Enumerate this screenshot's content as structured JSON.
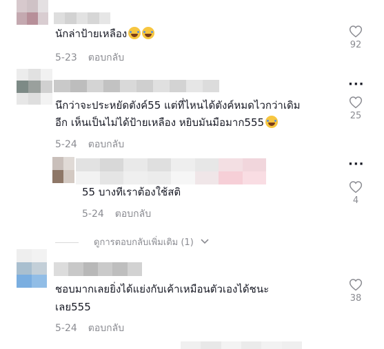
{
  "comments": [
    {
      "text_lines": [
        "นักล่าป้ายเหลือง"
      ],
      "emoji_count": 2,
      "date": "5-23",
      "reply_label": "ตอบกลับ",
      "likes": "92"
    },
    {
      "text_lines": [
        "นึกว่าจะประหยัดตังค์55 แต่ที่ไหนได้ตังค์หมดไวกว่าเดิม",
        "อีก เห็นเป็นไม่ได้ป้ายเหลือง หยิบมันมือมาก555"
      ],
      "emoji_count": 1,
      "date": "5-24",
      "reply_label": "ตอบกลับ",
      "likes": "25",
      "replies": [
        {
          "text_lines": [
            "55 บางทีเราต้องใช้สติ"
          ],
          "date": "5-24",
          "reply_label": "ตอบกลับ",
          "likes": "4"
        }
      ],
      "view_more": "ดูการตอบกลับเพิ่มเติม (1)"
    },
    {
      "text_lines": [
        "ชอบมากเลยยิ่งได้แย่งกับเค้าเหมือนตัวเองได้ชนะ",
        "เลย555"
      ],
      "date": "5-24",
      "reply_label": "ตอบกลับ",
      "likes": "38"
    }
  ],
  "icons": {
    "like": "heart-outline-icon",
    "more": "more-dots-icon",
    "expand": "chevron-down-icon"
  },
  "colors": {
    "text": "#161823",
    "muted": "#8a8b91"
  }
}
